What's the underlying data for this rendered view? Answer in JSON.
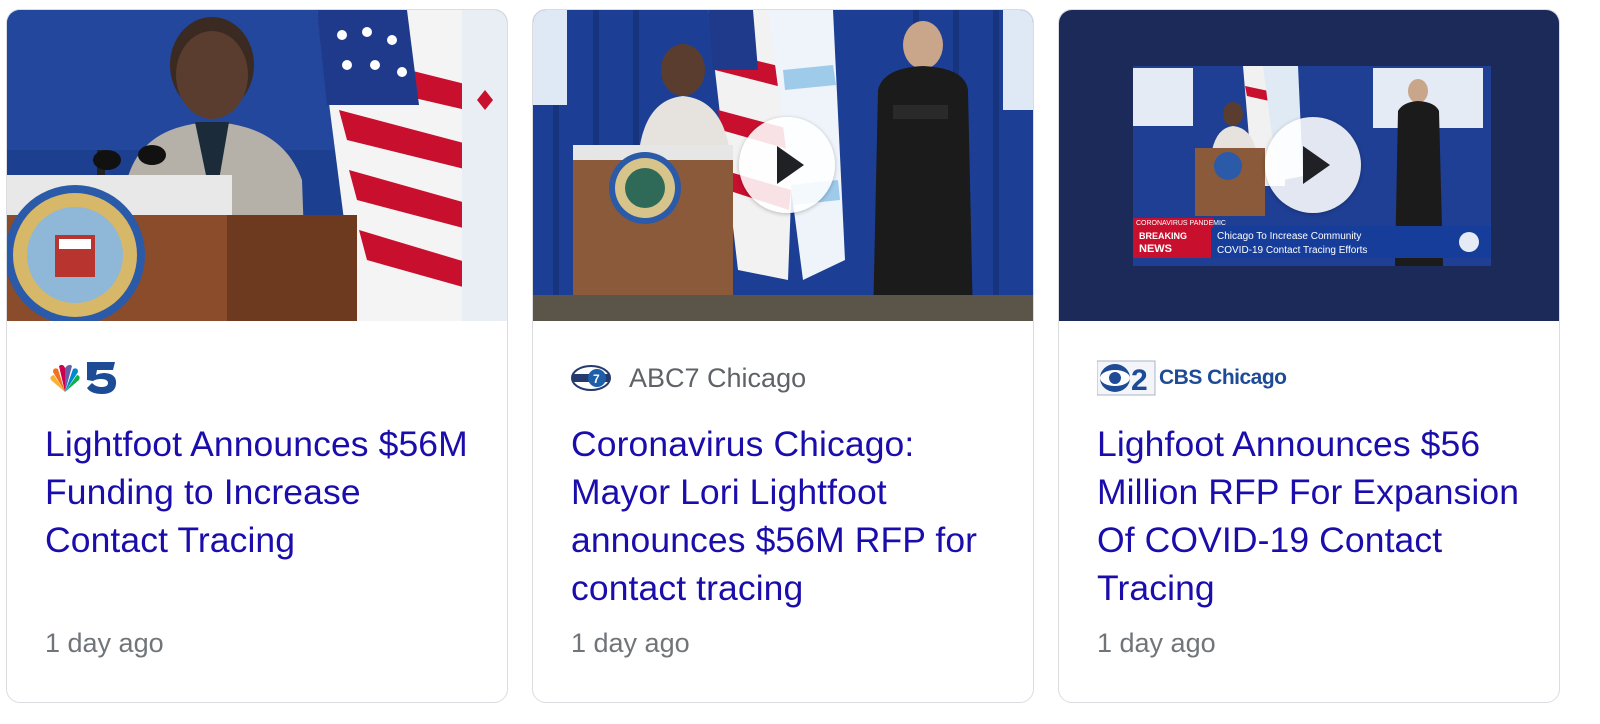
{
  "cards": [
    {
      "source": "NBC 5",
      "headline": "Lightfoot Announces $56M Funding to Increase Contact Tracing",
      "time": "1 day ago",
      "thumbnail": "photo of mayor at podium with City of Chicago seal and flags",
      "has_video": false
    },
    {
      "source": "ABC7 Chicago",
      "headline": "Coronavirus Chicago: Mayor Lori Lightfoot announces $56M RFP for contact tracing",
      "time": "1 day ago",
      "thumbnail": "mayor at podium with sign language interpreter and flags",
      "has_video": true
    },
    {
      "source": "CBS Chicago",
      "logo_number": "2",
      "headline": "Lighfoot Announces $56 Million RFP For Expansion Of COVID-19 Contact Tracing",
      "time": "1 day ago",
      "thumbnail": "news broadcast frame of press conference",
      "has_video": true,
      "ticker": {
        "banner": "CORONAVIRUS PANDEMIC",
        "brand_line1": "BREAKING",
        "brand_line2": "NEWS",
        "line1": "Chicago To Increase Community",
        "line2": "COVID-19 Contact Tracing Efforts"
      }
    }
  ],
  "colors": {
    "headline": "#1a0dab",
    "meta": "#70757a",
    "card_border": "#dadce0",
    "thumb3_bg": "#1c2a5a"
  }
}
